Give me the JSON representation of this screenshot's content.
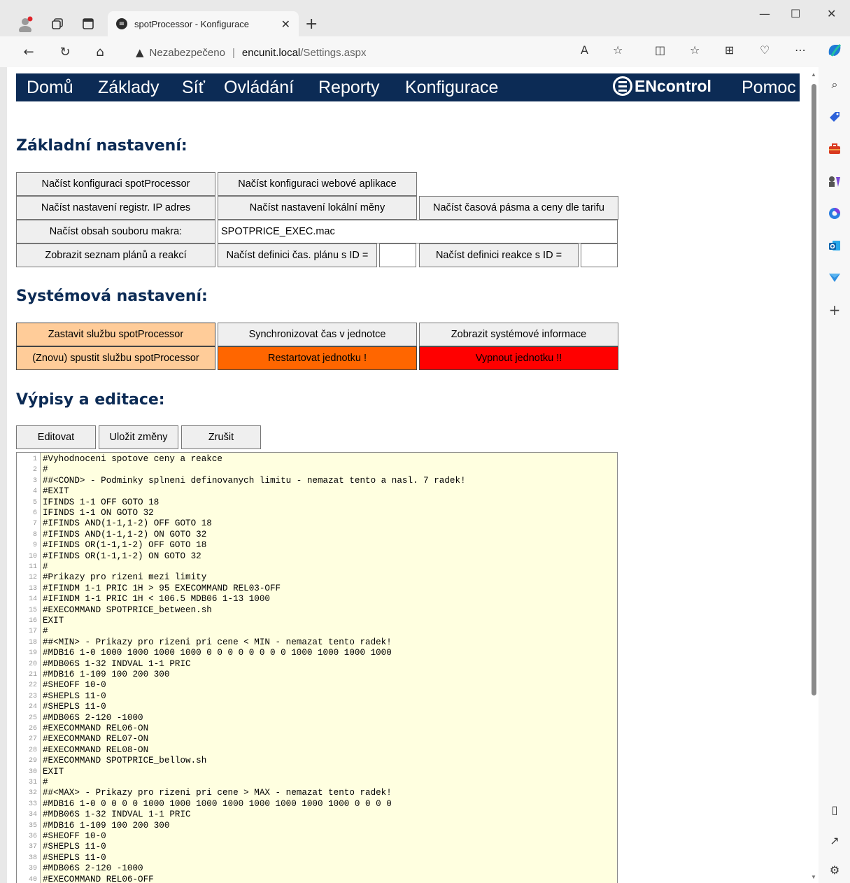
{
  "browser": {
    "tab_title": "spotProcessor - Konfigurace",
    "tab_close": "✕",
    "new_tab": "+",
    "address_insecure_label": "Nezabezpečeno",
    "address_separator": "|",
    "address_host": "encunit.local",
    "address_path": "/Settings.aspx",
    "icons": [
      "profile-icon",
      "workspaces-icon",
      "tab-actions-icon",
      "back-icon",
      "refresh-icon",
      "home-icon",
      "warning-icon",
      "read-aloud-icon",
      "favorite-star-icon",
      "split-screen-icon",
      "favorites-icon",
      "collections-icon",
      "browser-essentials-icon",
      "more-icon",
      "copilot-icon"
    ],
    "glyphs": {
      "minimize": "—",
      "maximize": "☐",
      "close": "✕",
      "back": "←",
      "refresh": "↻",
      "home": "⌂",
      "warning": "▲",
      "read_aloud": "A",
      "star": "☆",
      "split": "◫",
      "favorites": "☆",
      "collections": "⊞",
      "essentials": "♡",
      "more": "⋯"
    }
  },
  "sidebar": {
    "icons": [
      "search-icon",
      "shopping-tag-icon",
      "tools-icon",
      "games-icon",
      "microsoft365-icon",
      "outlook-icon",
      "send-icon",
      "add-icon",
      "hide-sidebar-icon",
      "external-link-icon",
      "settings-icon"
    ],
    "glyphs": {
      "search": "⌕",
      "add": "+",
      "panel": "▯",
      "external": "↗",
      "settings": "⚙"
    }
  },
  "nav": {
    "items": [
      "Domů",
      "Základy",
      "Síť",
      "Ovládání",
      "Reporty",
      "Konfigurace"
    ],
    "logo_text": "ENcontrol",
    "help": "Pomoc"
  },
  "basic": {
    "heading": "Základní nastavení:",
    "load_sp_config": "Načíst konfiguraci spotProcessor",
    "load_web_config": "Načíst konfiguraci webové aplikace",
    "load_ip_settings": "Načíst nastavení registr. IP adres",
    "load_currency": "Načíst nastavení lokální měny",
    "load_timezones": "Načíst časová pásma a ceny dle tarifu",
    "load_macro": "Načíst obsah souboru makra:",
    "macro_file": "SPOTPRICE_EXEC.mac",
    "show_plans": "Zobrazit seznam plánů a reakcí",
    "load_plan_def": "Načíst definici čas. plánu s ID =",
    "plan_id": "",
    "load_reaction_def": "Načíst definici reakce s ID =",
    "reaction_id": ""
  },
  "system": {
    "heading": "Systémová nastavení:",
    "stop_service": "Zastavit službu spotProcessor",
    "sync_time": "Synchronizovat čas v jednotce",
    "show_sysinfo": "Zobrazit systémové informace",
    "restart_service": "(Znovu) spustit službu spotProcessor",
    "restart_unit": "Restartovat jednotku !",
    "shutdown_unit": "Vypnout jednotku !!",
    "colors": {
      "peach": "#ffcc99",
      "orange": "#ff6600",
      "red": "#ff0000"
    }
  },
  "editing": {
    "heading": "Výpisy a editace:",
    "edit": "Editovat",
    "save": "Uložit změny",
    "cancel": "Zrušit",
    "lines": [
      "#Vyhodnoceni spotove ceny a reakce",
      "#",
      "##<COND> - Podminky splneni definovanych limitu - nemazat tento a nasl. 7 radek!",
      "#EXIT",
      "IFINDS 1-1 OFF GOTO 18",
      "IFINDS 1-1 ON GOTO 32",
      "#IFINDS AND(1-1,1-2) OFF GOTO 18",
      "#IFINDS AND(1-1,1-2) ON GOTO 32",
      "#IFINDS OR(1-1,1-2) OFF GOTO 18",
      "#IFINDS OR(1-1,1-2) ON GOTO 32",
      "#",
      "#Prikazy pro rizeni mezi limity",
      "#IFINDM 1-1 PRIC 1H > 95 EXECOMMAND REL03-OFF",
      "#IFINDM 1-1 PRIC 1H < 106.5 MDB06 1-13 1000",
      "#EXECOMMAND SPOTPRICE_between.sh",
      "EXIT",
      "#",
      "##<MIN> - Prikazy pro rizeni pri cene < MIN - nemazat tento radek!",
      "#MDB16 1-0 1000 1000 1000 1000 0 0 0 0 0 0 0 0 1000 1000 1000 1000",
      "#MDB06S 1-32 INDVAL 1-1 PRIC",
      "#MDB16 1-109 100 200 300",
      "#SHEOFF 10-0",
      "#SHEPLS 11-0",
      "#SHEPLS 11-0",
      "#MDB06S 2-120 -1000",
      "#EXECOMMAND REL06-ON",
      "#EXECOMMAND REL07-ON",
      "#EXECOMMAND REL08-ON",
      "#EXECOMMAND SPOTPRICE_bellow.sh",
      "EXIT",
      "#",
      "##<MAX> - Prikazy pro rizeni pri cene > MAX - nemazat tento radek!",
      "#MDB16 1-0 0 0 0 0 1000 1000 1000 1000 1000 1000 1000 1000 0 0 0 0",
      "#MDB06S 1-32 INDVAL 1-1 PRIC",
      "#MDB16 1-109 100 200 300",
      "#SHEOFF 10-0",
      "#SHEPLS 11-0",
      "#SHEPLS 11-0",
      "#MDB06S 2-120 -1000",
      "#EXECOMMAND REL06-OFF"
    ]
  }
}
